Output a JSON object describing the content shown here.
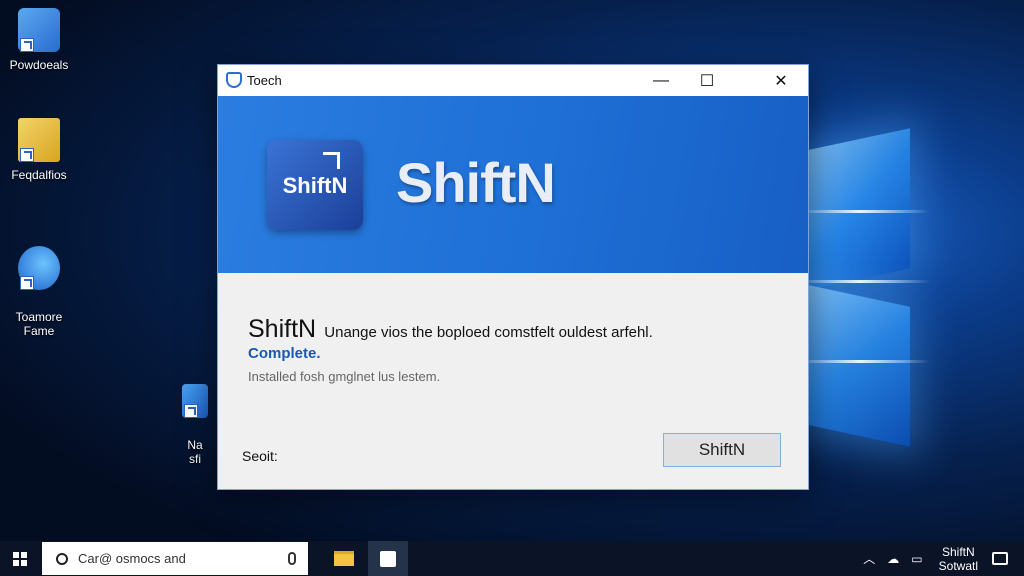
{
  "desktop": {
    "icons": [
      {
        "label": "Powdoeals"
      },
      {
        "label": "Feqdalfios"
      },
      {
        "label": "Toamore\nFame"
      },
      {
        "label": "Na\nsfi"
      }
    ]
  },
  "dialog": {
    "title": "Toech",
    "banner_app_tile_text": "ShiftN",
    "banner_title": "ShiftN",
    "message_app": "ShiftN",
    "message_text": "Unange vios the boploed comstfelt ouldest arfehl.",
    "status": "Complete.",
    "sub_text": "Installed fosh gmglnet lus lestem.",
    "bottom_label": "Seoit:",
    "main_button": "ShiftN",
    "controls": {
      "minimize": "—",
      "maximize": "☐",
      "close": "✕"
    }
  },
  "taskbar": {
    "search_placeholder": "Car@ osmocs and",
    "tray_clock_line1": "ShiftN",
    "tray_clock_line2": "Sotwatl"
  },
  "colors": {
    "accent": "#1e6fd6",
    "status_blue": "#1b58b0",
    "taskbar": "#0b1426"
  }
}
